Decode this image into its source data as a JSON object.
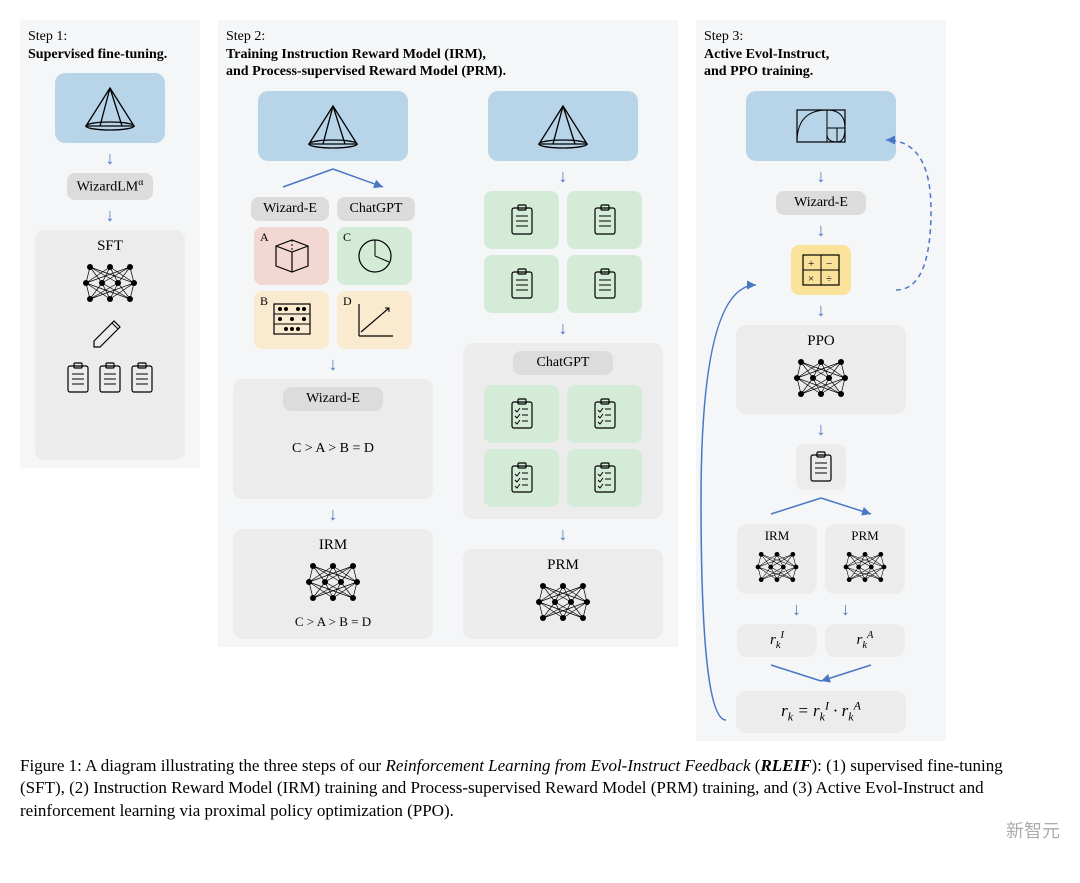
{
  "steps": {
    "s1": {
      "num": "Step 1:",
      "title": "Supervised fine-tuning."
    },
    "s2": {
      "num": "Step 2:",
      "title": "Training Instruction Reward Model (IRM),\nand Process-supervised Reward Model (PRM)."
    },
    "s3": {
      "num": "Step 3:",
      "title": "Active Evol-Instruct,\nand PPO training."
    }
  },
  "labels": {
    "wizardlm_alpha": "WizardLM",
    "sft": "SFT",
    "wizard_e": "Wizard-E",
    "chatgpt": "ChatGPT",
    "a": "A",
    "b": "B",
    "c": "C",
    "d": "D",
    "rank": "C > A > B = D",
    "irm": "IRM",
    "prm": "PRM",
    "ppo": "PPO",
    "rk_i": "r_k^I",
    "rk_a": "r_k^A",
    "eq": "r_k = r_k^I · r_k^A"
  },
  "caption": {
    "fig": "Figure 1:",
    "body1": " A diagram illustrating the three steps of our ",
    "ital1": "Reinforcement Learning from Evol-Instruct Feedback",
    "paren_open": " (",
    "bold": "RLEIF",
    "paren_close": "): ",
    "body2": "(1) supervised fine-tuning (SFT), (2) Instruction Reward Model (IRM) training and Process-supervised Reward Model (PRM) training, and (3) Active Evol-Instruct and reinforcement learning via proximal policy optimization (PPO)."
  },
  "watermark": "新智元"
}
